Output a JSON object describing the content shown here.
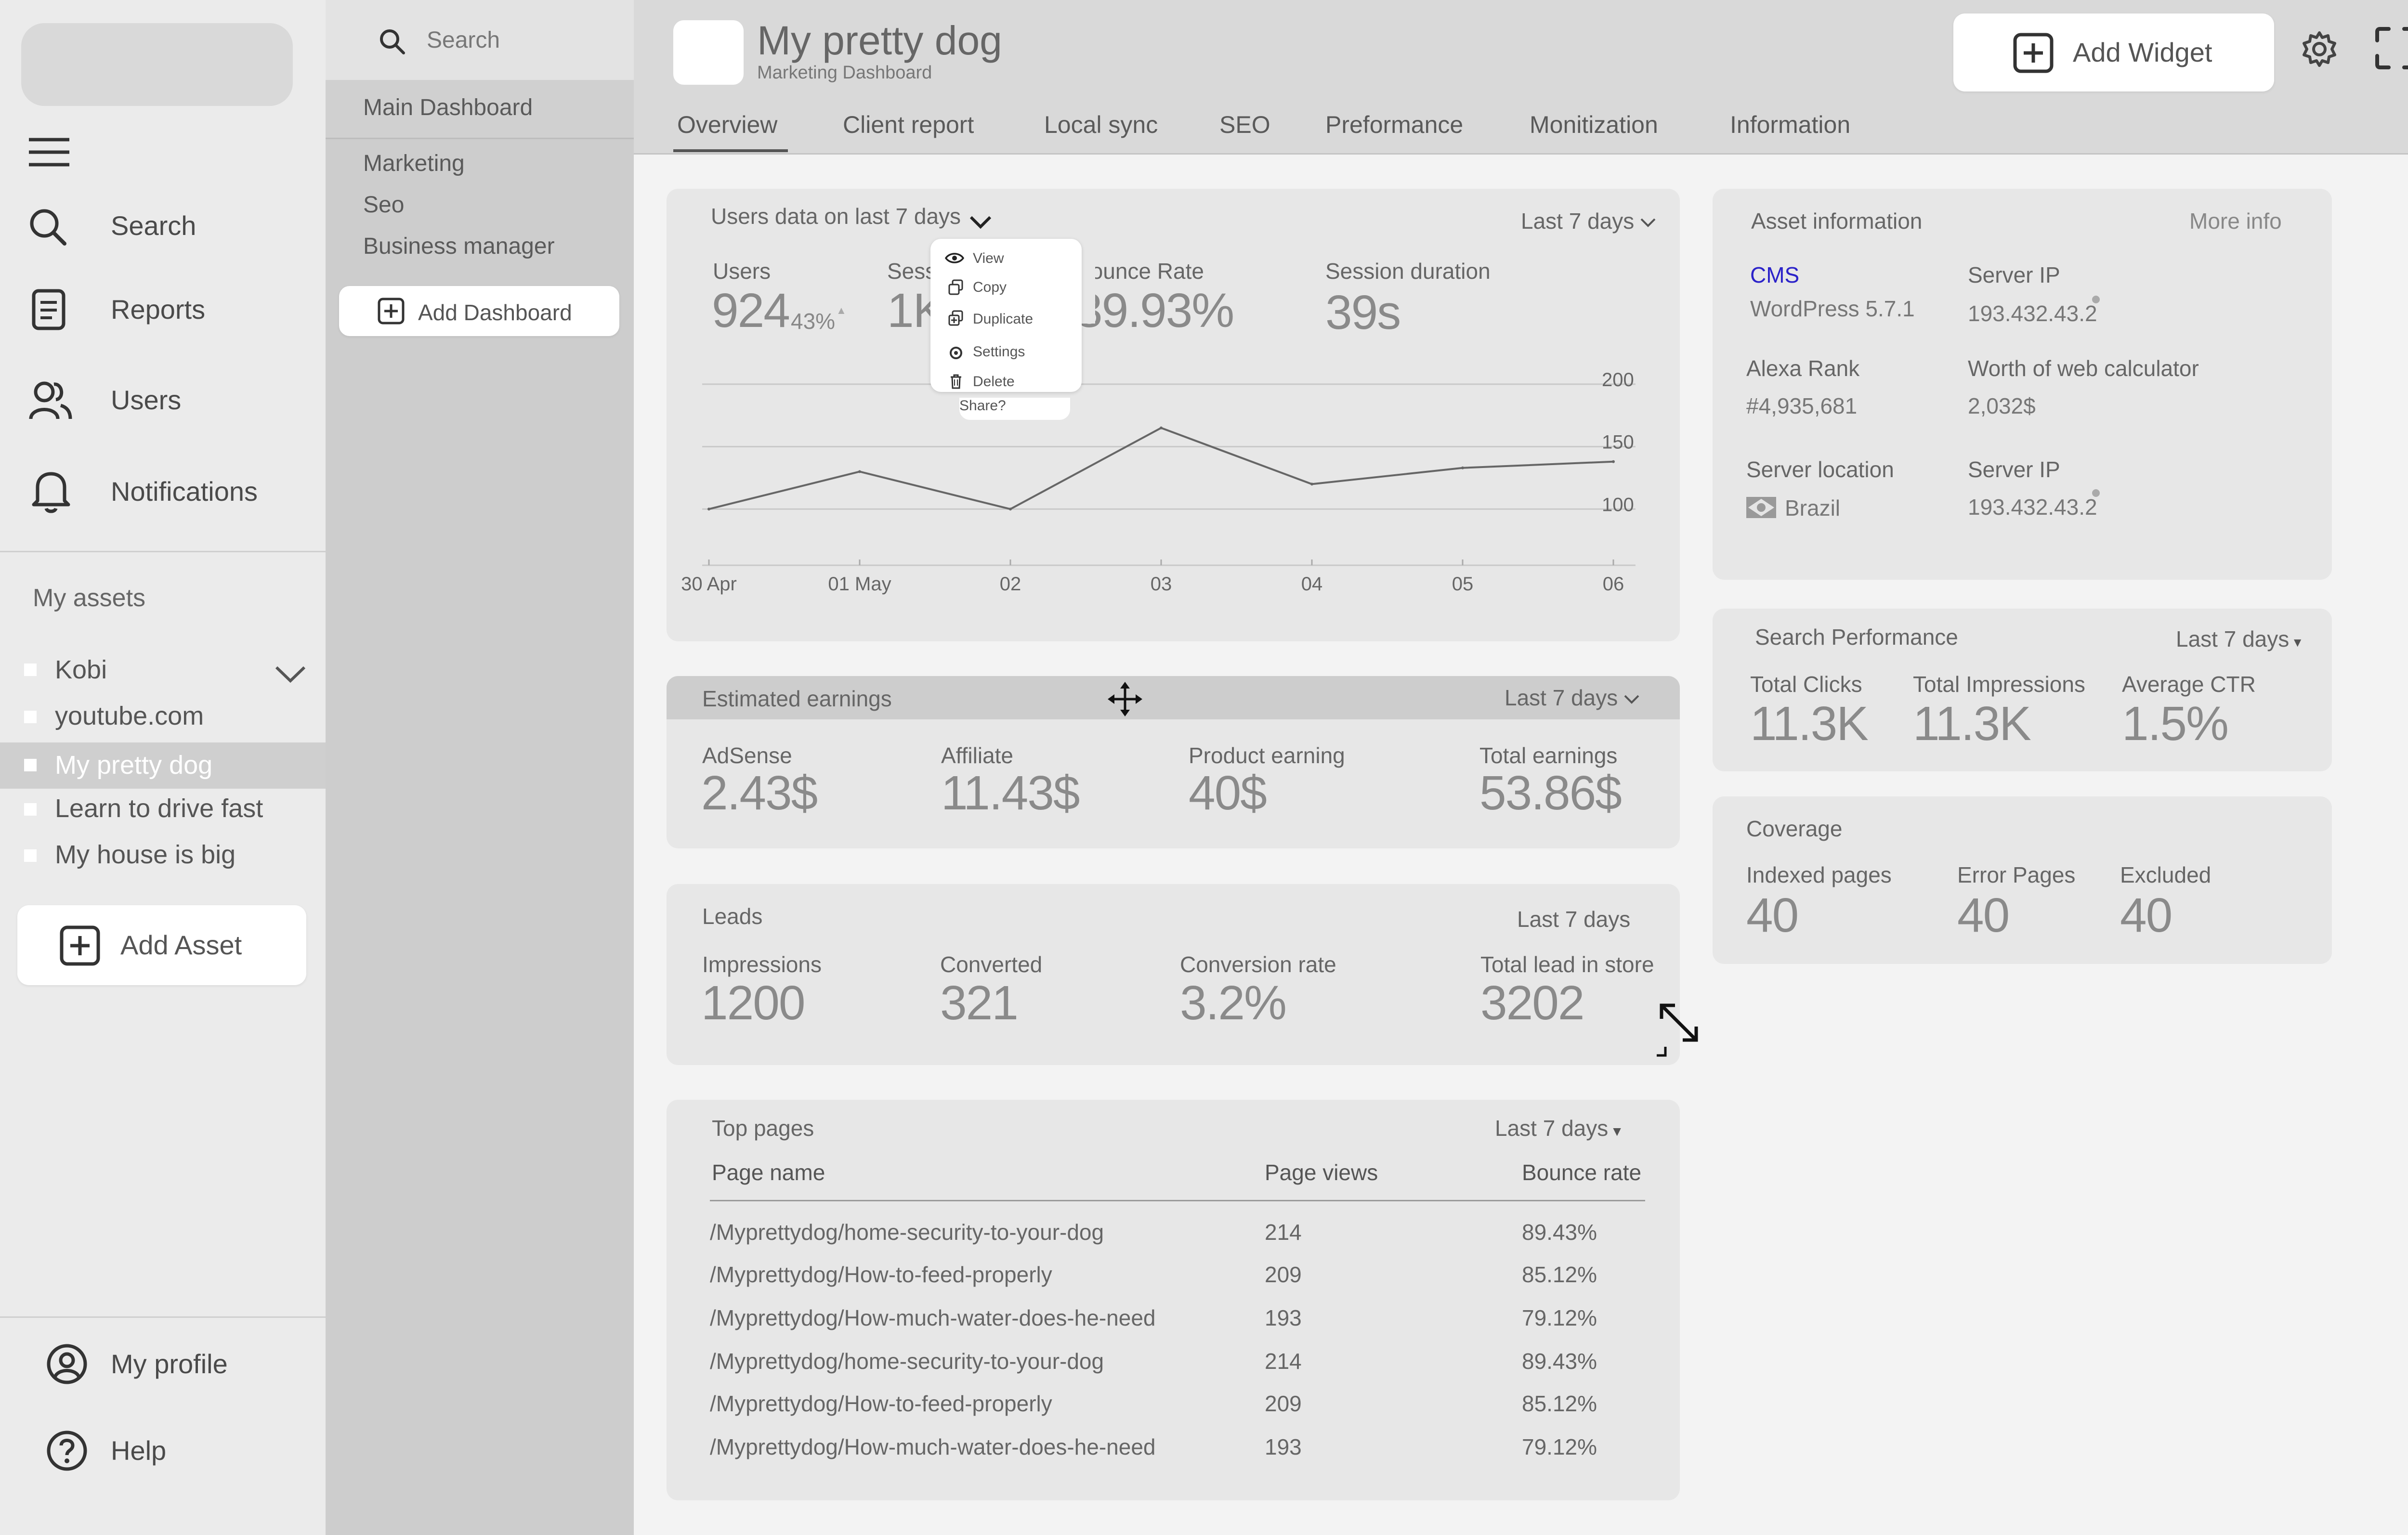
{
  "nav": {
    "items": [
      {
        "label": "Search",
        "icon": "search-icon"
      },
      {
        "label": "Reports",
        "icon": "reports-icon"
      },
      {
        "label": "Users",
        "icon": "users-icon"
      },
      {
        "label": "Notifications",
        "icon": "bell-icon"
      }
    ],
    "assets_heading": "My assets",
    "assets": [
      {
        "label": "Kobi"
      },
      {
        "label": "youtube.com"
      },
      {
        "label": "My pretty dog",
        "selected": true
      },
      {
        "label": "Learn to drive fast"
      },
      {
        "label": "My house is big"
      }
    ],
    "add_asset": "Add Asset",
    "profile": "My profile",
    "help": "Help"
  },
  "subnav": {
    "search_placeholder": "Search",
    "main": "Main Dashboard",
    "items": [
      "Marketing",
      "Seo",
      "Business manager"
    ],
    "add_dashboard": "Add Dashboard"
  },
  "header": {
    "title": "My pretty dog",
    "subtitle": "Marketing Dashboard",
    "add_widget": "Add Widget",
    "tabs": [
      "Overview",
      "Client report",
      "Local sync",
      "SEO",
      "Preformance",
      "Monitization",
      "Information"
    ],
    "active_tab": "Overview"
  },
  "users_card": {
    "title": "Users data on last 7 days",
    "range": "Last 7 days",
    "stats": {
      "users_label": "Users",
      "users_value": "924",
      "users_change": "43%",
      "sessions_label": "Sess",
      "sessions_value": "1K",
      "bounce_label": "Bounce Rate",
      "bounce_value": "39.93%",
      "duration_label": "Session duration",
      "duration_value": "39s"
    },
    "menu": [
      "View",
      "Copy",
      "Duplicate",
      "Settings",
      "Delete",
      "Share?"
    ]
  },
  "chart_data": {
    "type": "line",
    "x": [
      "30 Apr",
      "01 May",
      "02",
      "03",
      "04",
      "05",
      "06"
    ],
    "y_ticks": [
      100,
      150,
      200
    ],
    "series": [
      {
        "values": [
          100,
          130,
          100,
          165,
          120,
          133,
          138
        ]
      }
    ],
    "ylim": [
      55,
      210
    ],
    "grid": true
  },
  "earnings_card": {
    "title": "Estimated earnings",
    "range": "Last 7 days",
    "stats": [
      {
        "label": "AdSense",
        "value": "2.43$"
      },
      {
        "label": "Affiliate",
        "value": "11.43$"
      },
      {
        "label": "Product earning",
        "value": "40$"
      },
      {
        "label": "Total earnings",
        "value": "53.86$"
      }
    ]
  },
  "leads_card": {
    "title": "Leads",
    "range": "Last 7 days",
    "stats": [
      {
        "label": "Impressions",
        "value": "1200"
      },
      {
        "label": "Converted",
        "value": "321"
      },
      {
        "label": "Conversion rate",
        "value": "3.2%"
      },
      {
        "label": "Total lead in store",
        "value": "3202"
      }
    ]
  },
  "top_pages": {
    "title": "Top pages",
    "range": "Last 7 days",
    "columns": [
      "Page name",
      "Page views",
      "Bounce rate"
    ],
    "rows": [
      [
        "/Myprettydog/home-security-to-your-dog",
        "214",
        "89.43%"
      ],
      [
        "/Myprettydog/How-to-feed-properly",
        "209",
        "85.12%"
      ],
      [
        "/Myprettydog/How-much-water-does-he-need",
        "193",
        "79.12%"
      ],
      [
        "/Myprettydog/home-security-to-your-dog",
        "214",
        "89.43%"
      ],
      [
        "/Myprettydog/How-to-feed-properly",
        "209",
        "85.12%"
      ],
      [
        "/Myprettydog/How-much-water-does-he-need",
        "193",
        "79.12%"
      ]
    ]
  },
  "asset_info": {
    "title": "Asset information",
    "more": "More info",
    "cms_label": "CMS",
    "cms_value": "WordPress 5.7.1",
    "server_ip_label": "Server IP",
    "server_ip_value": "193.432.43.2",
    "alexa_label": "Alexa Rank",
    "alexa_value": "#4,935,681",
    "worth_label": "Worth of web calculator",
    "worth_value": "2,032$",
    "location_label": "Server location",
    "location_value": "Brazil",
    "server_ip2_label": "Server IP",
    "server_ip2_value": "193.432.43.2",
    "accent": "#2b22c9"
  },
  "search_perf": {
    "title": "Search Performance",
    "range": "Last 7 days",
    "stats": [
      {
        "label": "Total Clicks",
        "value": "11.3K"
      },
      {
        "label": "Total Impressions",
        "value": "11.3K"
      },
      {
        "label": "Average CTR",
        "value": "1.5%"
      }
    ]
  },
  "coverage": {
    "title": "Coverage",
    "stats": [
      {
        "label": "Indexed pages",
        "value": "40"
      },
      {
        "label": "Error Pages",
        "value": "40"
      },
      {
        "label": "Excluded",
        "value": "40"
      }
    ]
  }
}
